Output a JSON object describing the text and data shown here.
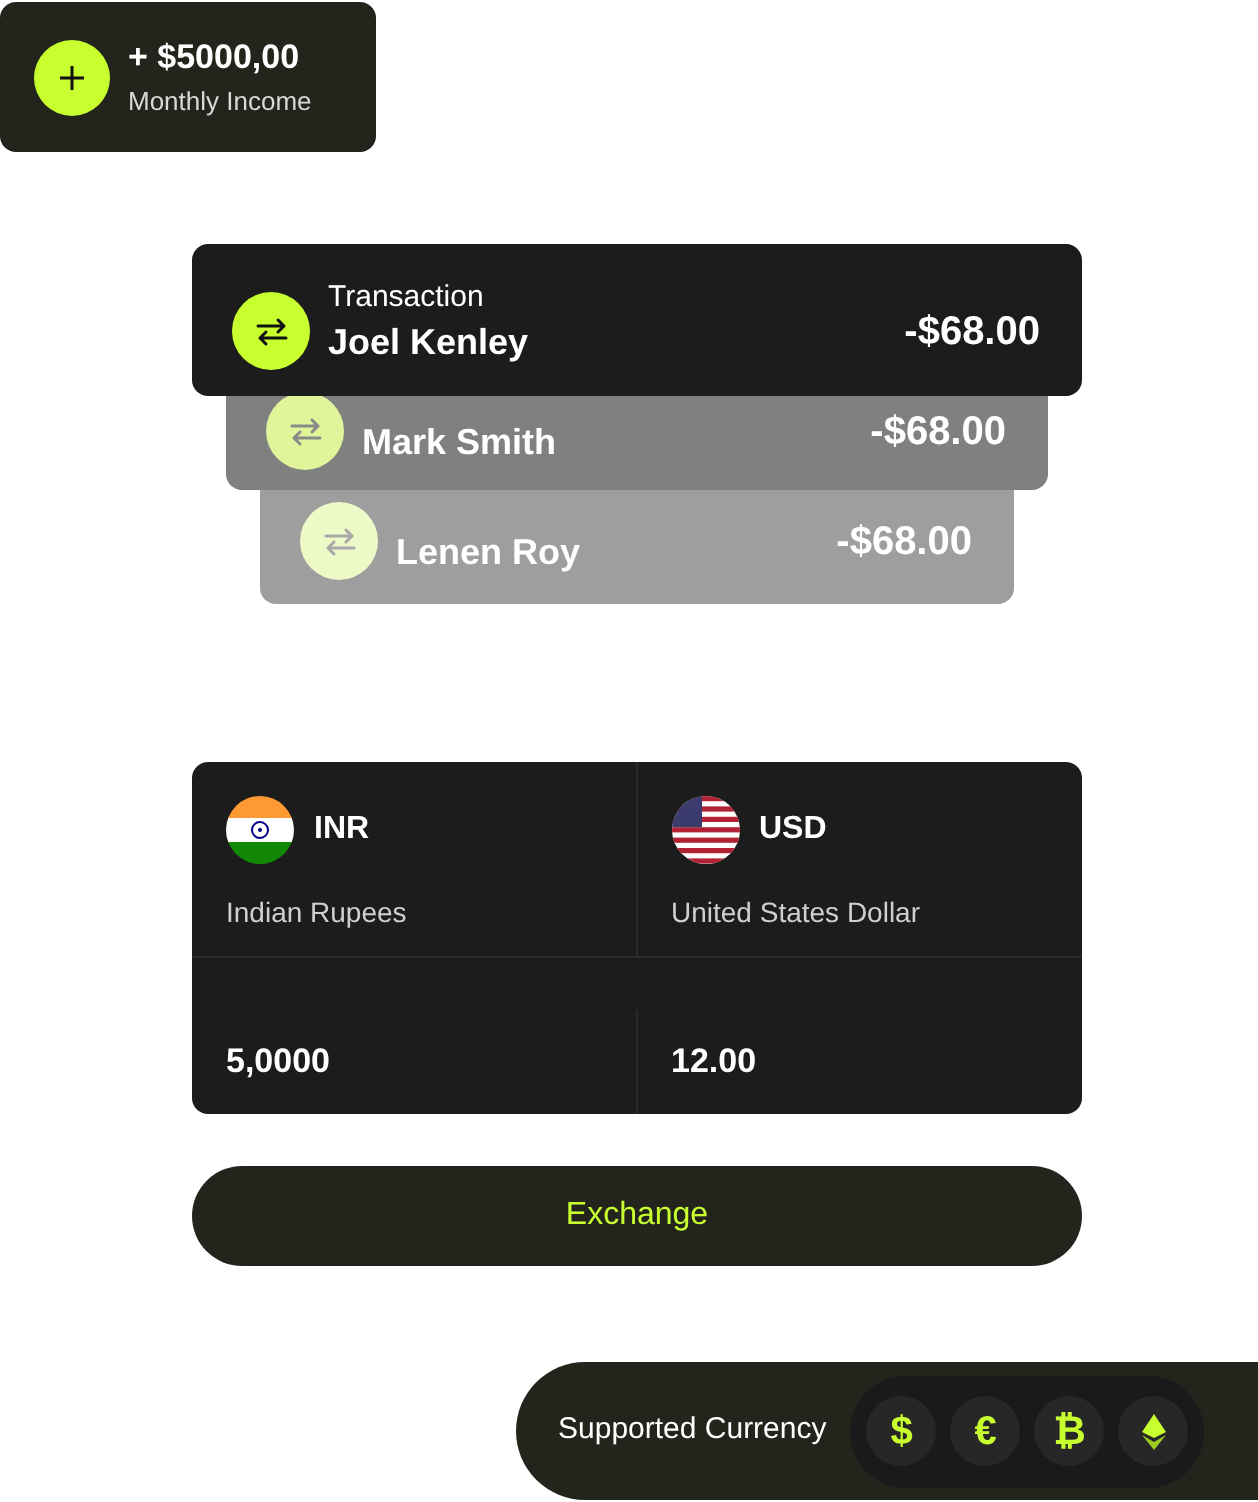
{
  "income": {
    "amount": "+ $5000,00",
    "label": "Monthly Income"
  },
  "transactions": [
    {
      "label": "Transaction",
      "name": "Joel Kenley",
      "amount": "-$68.00"
    },
    {
      "name": "Mark Smith",
      "amount": "-$68.00"
    },
    {
      "name": "Lenen Roy",
      "amount": "-$68.00"
    }
  ],
  "exchange": {
    "currencies": [
      {
        "kind": "india",
        "code": "INR",
        "name": "Indian Rupees",
        "value": "5,0000"
      },
      {
        "kind": "usa",
        "code": "USD",
        "name": "United States Dollar",
        "value": "12.00"
      }
    ],
    "button": "Exchange"
  },
  "supported": {
    "label": "Supported Currency",
    "symbols": [
      {
        "kind": "glyph",
        "glyph": "$"
      },
      {
        "kind": "glyph",
        "glyph": "€"
      },
      {
        "kind": "glyph",
        "glyph": "₿"
      },
      {
        "kind": "ethereum"
      }
    ]
  }
}
